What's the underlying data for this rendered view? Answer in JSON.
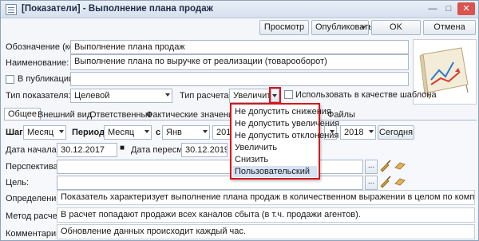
{
  "window": {
    "title": "[Показатели] - Выполнение плана продаж"
  },
  "toolbar": {
    "preview": "Просмотр",
    "publish": "Опубликовать",
    "ok": "OK",
    "cancel": "Отмена"
  },
  "form": {
    "code_label": "Обозначение (код):",
    "code_value": "Выполнение плана продаж",
    "name_label": "Наименование:",
    "name_value": "Выполнение плана по выручке от реализации (товарооборот)",
    "publication_label": "В публикации:",
    "indicator_type_label": "Тип показателя:",
    "indicator_type_value": "Целевой",
    "calc_type_label": "Тип расчета % :",
    "calc_type_value": "Увеличить",
    "template_label": "Использовать в качестве шаблона"
  },
  "tabs": [
    "Общее",
    "Внешний вид",
    "Ответственные",
    "Фактические значения",
    "Файлы"
  ],
  "dropdown_options": [
    "Не допустить снижения",
    "Не допустить увеличения",
    "Не допустить отклонения",
    "Увеличить",
    "Снизить",
    "Пользовательский"
  ],
  "general": {
    "step_label": "Шаг:",
    "step_value": "Месяц",
    "period_label": "Период:",
    "period_value": "Месяц",
    "from_label": "с",
    "from_month": "Янв",
    "from_year": "201",
    "to_year": "2018",
    "today_button": "Сегодня",
    "start_date_label": "Дата начала:",
    "start_date_value": "30.12.2017",
    "review_date_label": "Дата пересмотра:",
    "review_date_value": "30.12.2019",
    "perspective_label": "Перспектива:",
    "goal_label": "Цель:",
    "definition_label": "Определение:",
    "definition_value": "Показатель характеризует выполнение плана продаж в количественном выражении в целом по компании.",
    "method_label": "Метод расчета:",
    "method_value": "В расчет попадают продажи всех каналов сбыта (в т.ч. продажи агентов).",
    "comment_label": "Комментарий:",
    "comment_value": "Обновление данных происходит каждый час."
  },
  "ellipsis": "...",
  "colors": {
    "highlight": "#d9151b",
    "selected_bg": "#d6e3f5",
    "chart_line": "#2f79c9",
    "chart_arrow": "#d93b2b"
  }
}
